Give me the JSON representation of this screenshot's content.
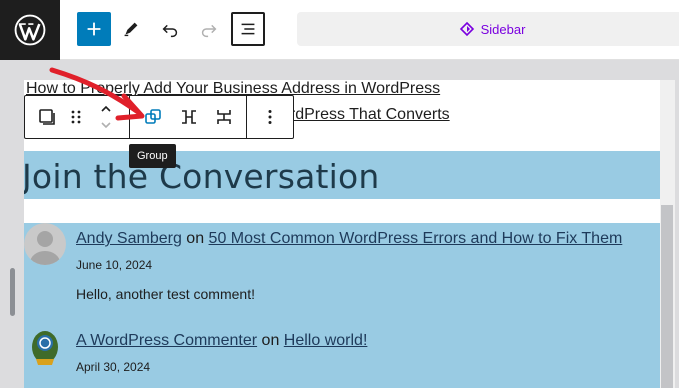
{
  "toolbar": {
    "document_title": "Sidebar"
  },
  "canvas": {
    "links": [
      "How to Properly Add Your Business Address in WordPress",
      "How to Create a Landing Page in WordPress That Converts"
    ],
    "heading": "Join the Conversation",
    "comments": [
      {
        "author": "Andy Samberg",
        "connector": "on",
        "post": "50 Most Common WordPress Errors and How to Fix Them",
        "date": "June 10, 2024",
        "text": "Hello, another test comment!"
      },
      {
        "author": "A WordPress Commenter",
        "connector": "on",
        "post": "Hello world!",
        "date": "April 30, 2024"
      }
    ]
  },
  "block_toolbar": {
    "tooltip": "Group"
  },
  "colors": {
    "accent": "#007cba",
    "selection": "#99cbe3",
    "annotation": "#e0202a",
    "site_editor": "#7a00df"
  }
}
